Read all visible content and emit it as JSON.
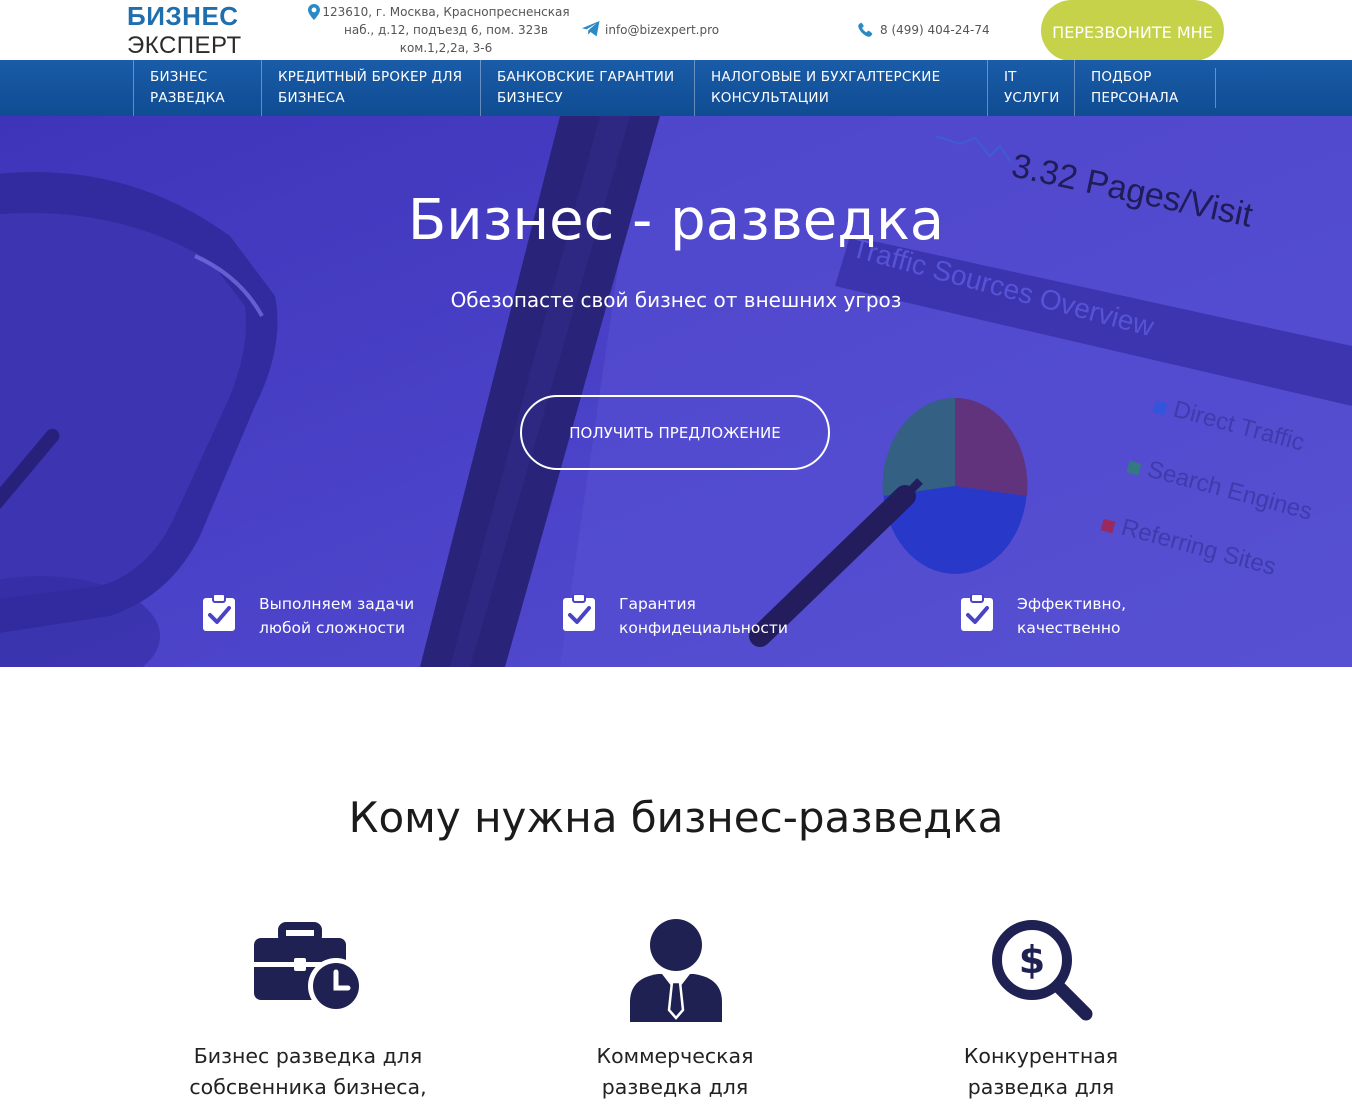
{
  "header": {
    "logo_line1": "БИЗНЕС",
    "logo_line2": "ЭКСПЕРТ",
    "address": "123610, г. Москва, Краснопресненская наб., д.12, подъезд 6, пом. 323в ком.1,2,2а, 3-6",
    "email": "info@bizexpert.pro",
    "phone": "8 (499) 404-24-74",
    "callback_button": "ПЕРЕЗВОНИТЕ МНЕ",
    "icons": [
      "map-pin-icon",
      "telegram-icon",
      "phone-icon"
    ]
  },
  "nav": {
    "items": [
      {
        "label": "БИЗНЕС РАЗВЕДКА"
      },
      {
        "label": "КРЕДИТНЫЙ БРОКЕР ДЛЯ БИЗНЕСА"
      },
      {
        "label": "БАНКОВСКИЕ ГАРАНТИИ БИЗНЕСУ"
      },
      {
        "label": "НАЛОГОВЫЕ И БУХГАЛТЕРСКИЕ КОНСУЛЬТАЦИИ"
      },
      {
        "label": "IT УСЛУГИ"
      },
      {
        "label": "ПОДБОР ПЕРСОНАЛА"
      }
    ]
  },
  "hero": {
    "title": "Бизнес - разведка",
    "subtitle": "Обезопасте свой бизнес от внешних угроз",
    "cta_button": "ПОЛУЧИТЬ ПРЕДЛОЖЕНИЕ",
    "background_text": {
      "metric": "3.32 Pages/Visit",
      "overview": "Traffic Sources Overview",
      "legend": [
        "Direct Traffic",
        "Search Engines",
        "Referring Sites"
      ]
    },
    "features": [
      {
        "line1": "Выполняем задачи",
        "line2": "любой сложности",
        "icon": "clipboard-check-icon"
      },
      {
        "line1": "Гарантия",
        "line2": "конфидециальности",
        "icon": "clipboard-check-icon"
      },
      {
        "line1": "Эффективно,",
        "line2": "качественно",
        "icon": "clipboard-check-icon"
      }
    ]
  },
  "section": {
    "title": "Кому нужна бизнес-разведка",
    "cards": [
      {
        "line1": "Бизнес разведка для",
        "line2": "собсвенника бизнеса,",
        "icon": "briefcase-clock-icon"
      },
      {
        "line1": "Коммерческая",
        "line2": "разведка для",
        "icon": "businessman-icon"
      },
      {
        "line1": "Конкурентная",
        "line2": "разведка для",
        "icon": "dollar-search-icon"
      }
    ]
  },
  "colors": {
    "brand_blue": "#1f6fae",
    "nav_blue": "#1a5ca8",
    "accent_green": "#c6d34a",
    "hero_overlay": "#4840c4",
    "icon_navy": "#1e2152"
  }
}
